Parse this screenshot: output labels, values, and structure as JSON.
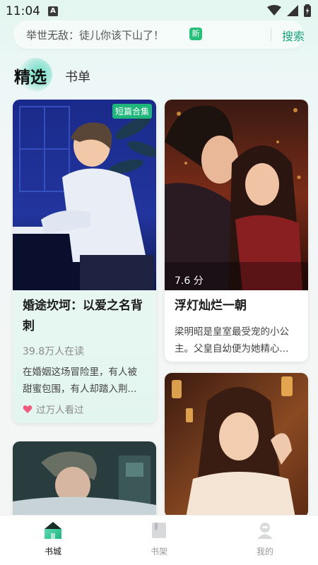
{
  "status_bar": {
    "time": "11:04",
    "notification_letter": "A"
  },
  "search": {
    "text": "举世无敌：徒儿你该下山了！",
    "badge": "新",
    "button_label": "搜索"
  },
  "tabs": [
    {
      "label": "精选",
      "active": true
    },
    {
      "label": "书单",
      "active": false
    }
  ],
  "cards": {
    "left1": {
      "tag": "短篇合集",
      "title": "婚途坎坷：以爱之名背刺",
      "readers": "39.8万人在读",
      "desc": "在婚姻这场冒险里，有人被甜蜜包围，有人却踏入荆...",
      "meta": "过万人看过"
    },
    "right1": {
      "rating": "7.6 分",
      "title": "浮灯灿烂一朝",
      "desc": "梁明昭是皇室最受宠的小公主。父皇自幼便为她精心..."
    }
  },
  "bottom_nav": [
    {
      "label": "书城",
      "icon": "home-icon",
      "active": true
    },
    {
      "label": "书架",
      "icon": "bookshelf-icon",
      "active": false
    },
    {
      "label": "我的",
      "icon": "profile-icon",
      "active": false
    }
  ],
  "colors": {
    "accent": "#1aa37a",
    "badge": "#27c07a",
    "active_nav": "#111111",
    "inactive_nav": "#999999"
  }
}
